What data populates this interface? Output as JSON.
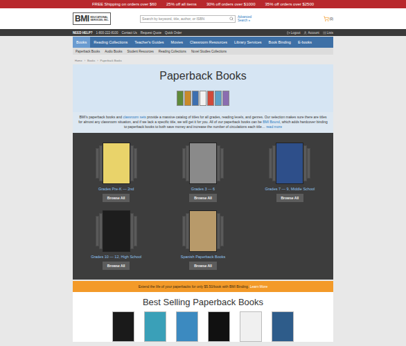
{
  "promo": [
    "FREE Shipping on orders over $60",
    "25% off all items",
    "30% off orders over $1000",
    "35% off orders over $2500"
  ],
  "logo": {
    "initials": "BMI",
    "line1": "EDUCATIONAL",
    "line2": "SERVICES, INC."
  },
  "search": {
    "placeholder": "Search by keyword, title, author, or ISBN",
    "advanced": "Advanced Search »"
  },
  "cart": {
    "count": "(0)"
  },
  "help": {
    "label": "NEED HELP?",
    "phone": "1-800-222-8100",
    "links": [
      "Contact Us",
      "Request Quote",
      "Quick Order"
    ]
  },
  "account_links": [
    {
      "label": "Logout",
      "kind": "logout"
    },
    {
      "label": "Account",
      "kind": "account"
    },
    {
      "label": "Lists",
      "kind": "lists"
    }
  ],
  "nav": [
    {
      "label": "Books",
      "selected": true
    },
    {
      "label": "Reading Collections",
      "selected": false
    },
    {
      "label": "Teacher's Guides",
      "selected": false
    },
    {
      "label": "Movies",
      "selected": false
    },
    {
      "label": "Classroom Resources",
      "selected": false
    },
    {
      "label": "Library Services",
      "selected": false
    },
    {
      "label": "Book Binding",
      "selected": false
    },
    {
      "label": "E-books",
      "selected": false
    }
  ],
  "subnav": [
    "Paperback Books",
    "Audio Books",
    "Student Resources",
    "Reading Collections",
    "Novel Studies Collections"
  ],
  "breadcrumb": {
    "items": [
      "Home",
      "Books",
      "Paperback Books"
    ],
    "separator": "›"
  },
  "hero": {
    "title": "Paperback Books",
    "books": [
      {
        "color": "#5f8a3a"
      },
      {
        "color": "#c98a2a"
      },
      {
        "color": "#3c6fb0"
      },
      {
        "color": "#f2f2f2"
      },
      {
        "color": "#d04a3a"
      },
      {
        "color": "#5aa0c8"
      },
      {
        "color": "#8a6db0"
      }
    ]
  },
  "intro": [
    {
      "text": "BMI's paperback books and ",
      "link": false
    },
    {
      "text": "classroom sets",
      "link": true
    },
    {
      "text": " provide a massive catalog of titles for all grades, reading levels, and genres. Our selection makes sure there are titles for almost any classroom situation, and if we lack a specific title, we will get it for you. All of our paperback books can be ",
      "link": false
    },
    {
      "text": "BMI Bound",
      "link": true
    },
    {
      "text": ", which adds hardcover binding to paperback books to both save money and increase the number of circulations each title…",
      "link": false
    },
    {
      "text": " read more",
      "link": true
    }
  ],
  "categories": [
    {
      "label": "Grades Pre-K — 2nd",
      "button": "Browse All",
      "color": "#e9d36a"
    },
    {
      "label": "Grades 3 — 6",
      "button": "Browse All",
      "color": "#8a8a8a"
    },
    {
      "label": "Grades 7 — 9, Middle School",
      "button": "Browse All",
      "color": "#2e4f8a"
    },
    {
      "label": "Grades 10 — 12, High School",
      "button": "Browse All",
      "color": "#1d1d1d"
    },
    {
      "label": "Spanish Paperback Books",
      "button": "Browse All",
      "color": "#b89a6a"
    }
  ],
  "banner": {
    "text": "Extend the life of your paperbacks for only $5.50/book with BMI Binding.",
    "link": "Learn More"
  },
  "bestsellers": {
    "title": "Best Selling Paperback Books",
    "books": [
      {
        "color": "#1a1a1a"
      },
      {
        "color": "#3aa0b8"
      },
      {
        "color": "#3c8ac0"
      },
      {
        "color": "#111111"
      },
      {
        "color": "#f0f0f0"
      },
      {
        "color": "#2e5c8a"
      }
    ]
  }
}
